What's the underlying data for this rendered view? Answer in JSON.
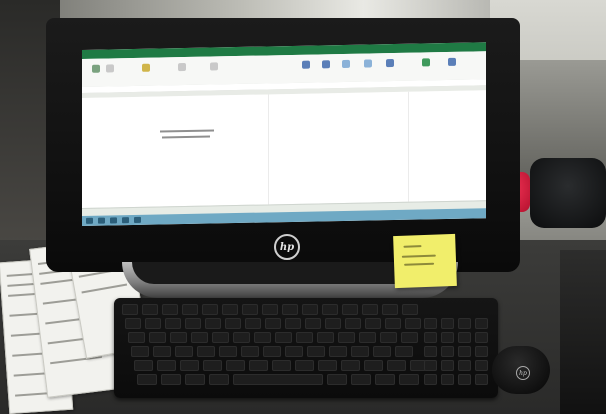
{
  "scene": {
    "monitor": {
      "brand_logo": "hp"
    },
    "mouse": {
      "brand_logo": "hp"
    },
    "screen": {
      "app_accent_color": "#1f7a44",
      "taskbar_color": "#6fa9c4"
    },
    "sticky_note": {
      "color": "#f1ee6b"
    }
  }
}
